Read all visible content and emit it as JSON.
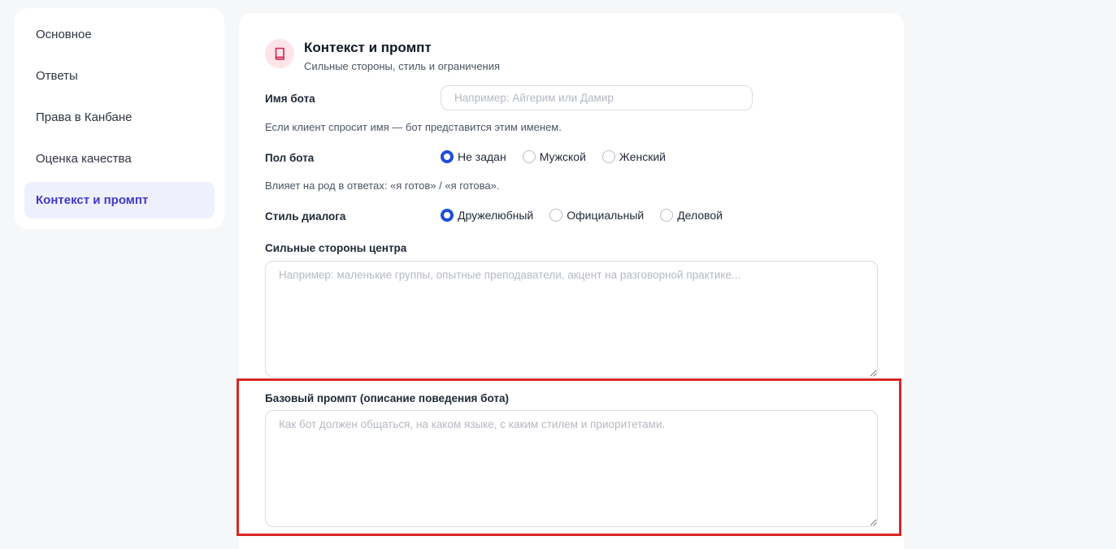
{
  "sidebar": {
    "items": [
      {
        "label": "Основное"
      },
      {
        "label": "Ответы"
      },
      {
        "label": "Права в Канбане"
      },
      {
        "label": "Оценка качества"
      },
      {
        "label": "Контекст и промпт"
      }
    ],
    "active_index": 4
  },
  "section": {
    "icon": "book-icon",
    "title": "Контекст и промпт",
    "subtitle": "Сильные стороны, стиль и ограничения"
  },
  "bot_name": {
    "label": "Имя бота",
    "placeholder": "Например: Айгерим или Дамир",
    "value": "",
    "hint": "Если клиент спросит имя — бот представится этим именем."
  },
  "bot_gender": {
    "label": "Пол бота",
    "options": [
      "Не задан",
      "Мужской",
      "Женский"
    ],
    "selected": "Не задан",
    "hint": "Влияет на род в ответах: «я готов» / «я готова»."
  },
  "dialog_style": {
    "label": "Стиль диалога",
    "options": [
      "Дружелюбный",
      "Официальный",
      "Деловой"
    ],
    "selected": "Дружелюбный"
  },
  "strengths": {
    "label": "Сильные стороны центра",
    "placeholder": "Например: маленькие группы, опытные преподаватели, акцент на разговорной практике..."
  },
  "base_prompt": {
    "label": "Базовый промпт (описание поведения бота)",
    "placeholder": "Как бот должен общаться, на каком языке, с каким стилем и приоритетами."
  },
  "colors": {
    "accent": "#1d4ed8",
    "active_nav_bg": "#eef1fd",
    "active_nav_text": "#4338ca",
    "icon_bg": "#fde4e8",
    "icon_fg": "#d61f4f",
    "highlight": "#d92626"
  }
}
